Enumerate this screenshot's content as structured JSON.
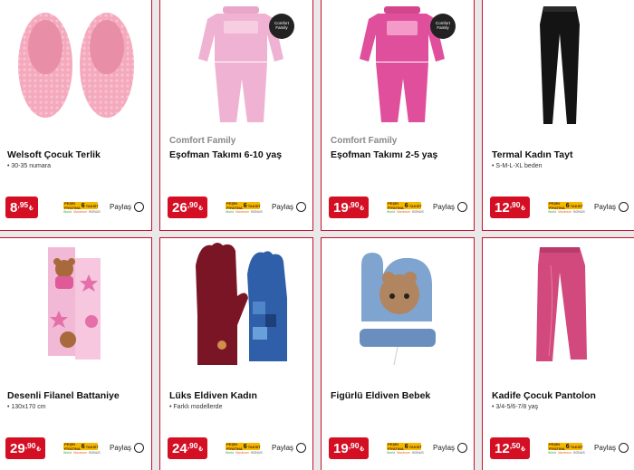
{
  "share_label": "Paylaş",
  "taksit": {
    "pesin": "PEŞİN FİYATINA",
    "count": "6",
    "word": "TAKSİT",
    "cards": [
      "World",
      "Maximum",
      "BONUS"
    ]
  },
  "badge": {
    "line1": "Comfort",
    "line2": "Family"
  },
  "products": [
    {
      "brand": "",
      "title": "Welsoft Çocuk Terlik",
      "sub": "• 30-35 numara",
      "price_int": "8",
      "price_dec": ",95",
      "currency": "₺",
      "image": "pink-fuzzy-slippers"
    },
    {
      "brand": "Comfort Family",
      "title": "Eşofman Takımı 6-10 yaş",
      "sub": "",
      "price_int": "26",
      "price_dec": ",90",
      "currency": "₺",
      "image": "light-pink-pajama-set",
      "badge": true
    },
    {
      "brand": "Comfort Family",
      "title": "Eşofman Takımı 2-5 yaş",
      "sub": "",
      "price_int": "19",
      "price_dec": ",90",
      "currency": "₺",
      "image": "pink-pajama-set",
      "badge": true
    },
    {
      "brand": "",
      "title": "Termal Kadın Tayt",
      "sub": "• S-M-L-XL beden",
      "price_int": "12",
      "price_dec": ",90",
      "currency": "₺",
      "image": "black-leggings"
    },
    {
      "brand": "",
      "title": "Desenli Filanel Battaniye",
      "sub": "• 130x170 cm",
      "price_int": "29",
      "price_dec": ",90",
      "currency": "₺",
      "image": "pink-teddy-blanket"
    },
    {
      "brand": "",
      "title": "Lüks Eldiven Kadın",
      "sub": "• Farklı modellerde",
      "price_int": "24",
      "price_dec": ",90",
      "currency": "₺",
      "image": "women-gloves"
    },
    {
      "brand": "",
      "title": "Figürlü Eldiven Bebek",
      "sub": "",
      "price_int": "19",
      "price_dec": ",90",
      "currency": "₺",
      "image": "baby-mittens"
    },
    {
      "brand": "",
      "title": "Kadife Çocuk Pantolon",
      "sub": "• 3/4-5/6-7/8 yaş",
      "price_int": "12",
      "price_dec": ",50",
      "currency": "₺",
      "image": "velvet-pants"
    }
  ]
}
